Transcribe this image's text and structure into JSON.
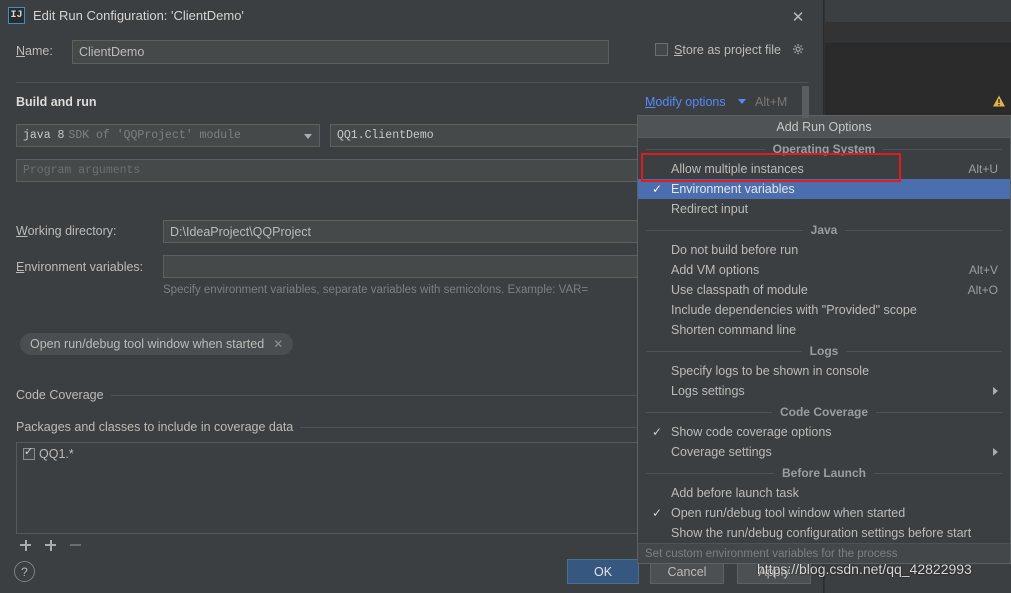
{
  "dialog": {
    "title": "Edit Run Configuration: 'ClientDemo'",
    "app_icon": "IJ",
    "close_icon": "✕"
  },
  "name_row": {
    "label": "Name:",
    "value": "ClientDemo",
    "store_as_project_file": "Store as project file",
    "gear_icon": "gear-icon"
  },
  "build_and_run": {
    "section_title": "Build and run",
    "modify_options": "Modify options",
    "modify_options_accel": "Alt+M",
    "sdk_primary": "java 8",
    "sdk_secondary": "SDK of 'QQProject' module",
    "main_class": "QQ1.ClientDemo",
    "program_arguments_placeholder": "Program arguments",
    "working_directory_label": "Working directory:",
    "working_directory_value": "D:\\IdeaProject\\QQProject",
    "environment_variables_label": "Environment variables:",
    "environment_variables_value": "",
    "environment_variables_hint": "Specify environment variables, separate variables with semicolons. Example: VAR=",
    "chip_label": "Open run/debug tool window when started",
    "chip_close_icon": "✕"
  },
  "code_coverage": {
    "section_title": "Code Coverage",
    "packages_title": "Packages and classes to include in coverage data",
    "rows": [
      {
        "checked": true,
        "text": "QQ1.*"
      }
    ]
  },
  "footer": {
    "help": "?",
    "ok": "OK",
    "cancel": "Cancel",
    "apply": "Apply"
  },
  "menu": {
    "header": "Add Run Options",
    "status": "Set custom environment variables for the process",
    "groups": [
      {
        "caption": "Operating System",
        "items": [
          {
            "label": "Allow multiple instances",
            "accel": "Alt+U",
            "checked": false,
            "selected": false,
            "submenu": false
          },
          {
            "label": "Environment variables",
            "accel": "",
            "checked": true,
            "selected": true,
            "submenu": false
          },
          {
            "label": "Redirect input",
            "accel": "",
            "checked": false,
            "selected": false,
            "submenu": false
          }
        ]
      },
      {
        "caption": "Java",
        "items": [
          {
            "label": "Do not build before run",
            "accel": "",
            "checked": false,
            "selected": false,
            "submenu": false
          },
          {
            "label": "Add VM options",
            "accel": "Alt+V",
            "checked": false,
            "selected": false,
            "submenu": false
          },
          {
            "label": "Use classpath of module",
            "accel": "Alt+O",
            "checked": false,
            "selected": false,
            "submenu": false
          },
          {
            "label": "Include dependencies with \"Provided\" scope",
            "accel": "",
            "checked": false,
            "selected": false,
            "submenu": false
          },
          {
            "label": "Shorten command line",
            "accel": "",
            "checked": false,
            "selected": false,
            "submenu": false
          }
        ]
      },
      {
        "caption": "Logs",
        "items": [
          {
            "label": "Specify logs to be shown in console",
            "accel": "",
            "checked": false,
            "selected": false,
            "submenu": false
          },
          {
            "label": "Logs settings",
            "accel": "",
            "checked": false,
            "selected": false,
            "submenu": true
          }
        ]
      },
      {
        "caption": "Code Coverage",
        "items": [
          {
            "label": "Show code coverage options",
            "accel": "",
            "checked": true,
            "selected": false,
            "submenu": false
          },
          {
            "label": "Coverage settings",
            "accel": "",
            "checked": false,
            "selected": false,
            "submenu": true
          }
        ]
      },
      {
        "caption": "Before Launch",
        "items": [
          {
            "label": "Add before launch task",
            "accel": "",
            "checked": false,
            "selected": false,
            "submenu": false
          },
          {
            "label": "Open run/debug tool window when started",
            "accel": "",
            "checked": true,
            "selected": false,
            "submenu": false
          },
          {
            "label": "Show the run/debug configuration settings before start",
            "accel": "",
            "checked": false,
            "selected": false,
            "submenu": false
          }
        ]
      }
    ]
  },
  "annotation": {
    "highlight_color": "#e21b1b",
    "highlighted_item": "Allow multiple instances"
  },
  "watermark": {
    "text": "https://blog.csdn.net/qq_42822993"
  },
  "colors": {
    "dialog_bg": "#3c3f41",
    "field_bg": "#45494a",
    "selection_blue": "#4b6eaf",
    "ok_button": "#365880",
    "link_blue": "#548af7",
    "warning_yellow": "#e3b341"
  }
}
